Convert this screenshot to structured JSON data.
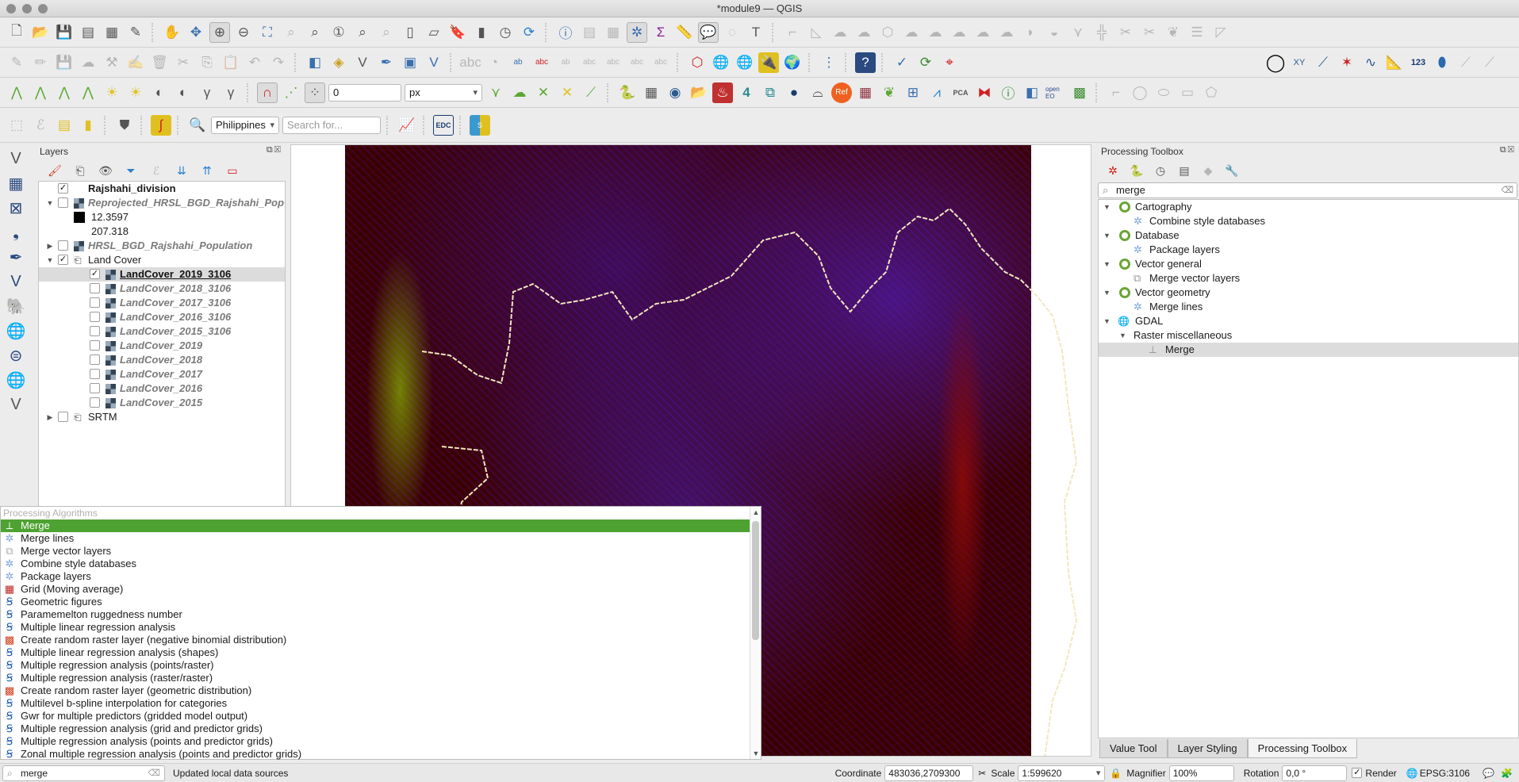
{
  "window": {
    "title": "*module9 — QGIS"
  },
  "toolbars": {
    "row1": [
      "new-project",
      "open-project",
      "save-project",
      "new-print-layout",
      "layout-manager",
      "style-manager",
      "pan",
      "pan-to-selection",
      "zoom-in",
      "zoom-out",
      "zoom-full",
      "zoom-to-selection",
      "zoom-to-layer",
      "zoom-native",
      "zoom-last",
      "zoom-next",
      "new-spatial-bookmark",
      "new-3d-map",
      "show-bookmarks",
      "temporal-controller",
      "refresh",
      "identify",
      "attribute-table",
      "field-calculator",
      "processing-toolbox",
      "statistical-summary",
      "measure",
      "map-tips",
      "select-features",
      "text-annotation"
    ],
    "snap_tolerance": "0",
    "snap_units": "px",
    "geocoder": {
      "country": "Philippines",
      "placeholder": "Search for..."
    },
    "edc_label": "EDC",
    "pca_label": "PCA",
    "ref_label": "Ref",
    "measure_123_label": "123",
    "openeo_label": "open EO"
  },
  "layers_panel": {
    "title": "Layers",
    "items": [
      {
        "name": "Rajshahi_division",
        "checked": true,
        "style": "bold",
        "indent": 1,
        "type": "vector"
      },
      {
        "name": "Reprojected_HRSL_BGD_Rajshahi_Pop",
        "checked": false,
        "style": "italic",
        "indent": 1,
        "expanded": true,
        "type": "raster"
      },
      {
        "name": "12.3597",
        "legend": true,
        "indent": 2
      },
      {
        "name": "207.318",
        "legend": true,
        "indent": 2,
        "nobox": true
      },
      {
        "name": "HRSL_BGD_Rajshahi_Population",
        "checked": false,
        "style": "italic",
        "indent": 1,
        "collapsed": true,
        "type": "raster"
      },
      {
        "name": "Land Cover",
        "checked": true,
        "style": "normal",
        "indent": 1,
        "expanded": true,
        "type": "group"
      },
      {
        "name": "LandCover_2019_3106",
        "checked": true,
        "style": "selected",
        "indent": 2,
        "type": "raster"
      },
      {
        "name": "LandCover_2018_3106",
        "checked": false,
        "style": "italic",
        "indent": 2,
        "type": "raster"
      },
      {
        "name": "LandCover_2017_3106",
        "checked": false,
        "style": "italic",
        "indent": 2,
        "type": "raster"
      },
      {
        "name": "LandCover_2016_3106",
        "checked": false,
        "style": "italic",
        "indent": 2,
        "type": "raster"
      },
      {
        "name": "LandCover_2015_3106",
        "checked": false,
        "style": "italic",
        "indent": 2,
        "type": "raster"
      },
      {
        "name": "LandCover_2019",
        "checked": false,
        "style": "italic",
        "indent": 2,
        "type": "raster"
      },
      {
        "name": "LandCover_2018",
        "checked": false,
        "style": "italic",
        "indent": 2,
        "type": "raster"
      },
      {
        "name": "LandCover_2017",
        "checked": false,
        "style": "italic",
        "indent": 2,
        "type": "raster"
      },
      {
        "name": "LandCover_2016",
        "checked": false,
        "style": "italic",
        "indent": 2,
        "type": "raster"
      },
      {
        "name": "LandCover_2015",
        "checked": false,
        "style": "italic",
        "indent": 2,
        "type": "raster"
      },
      {
        "name": "SRTM",
        "checked": false,
        "style": "normal",
        "indent": 1,
        "collapsed": true,
        "type": "group"
      }
    ]
  },
  "locator_popup": {
    "header": "Processing Algorithms",
    "items": [
      {
        "label": "Merge",
        "icon": "gdal-merge-icon",
        "selected": true
      },
      {
        "label": "Merge lines",
        "icon": "gear-icon"
      },
      {
        "label": "Merge vector layers",
        "icon": "merge-vector-icon"
      },
      {
        "label": "Combine style databases",
        "icon": "gear-icon"
      },
      {
        "label": "Package layers",
        "icon": "gear-icon"
      },
      {
        "label": "Grid (Moving average)",
        "icon": "grid-icon"
      },
      {
        "label": "Geometric figures",
        "icon": "saga-icon"
      },
      {
        "label": "Paramemelton ruggedness number",
        "icon": "saga-icon"
      },
      {
        "label": "Multiple linear regression analysis",
        "icon": "saga-icon"
      },
      {
        "label": "Create random raster layer (negative binomial distribution)",
        "icon": "random-raster-icon"
      },
      {
        "label": "Multiple linear regression analysis (shapes)",
        "icon": "saga-icon"
      },
      {
        "label": "Multiple regression analysis (points/raster)",
        "icon": "saga-icon"
      },
      {
        "label": "Multiple regression analysis (raster/raster)",
        "icon": "saga-icon"
      },
      {
        "label": "Create random raster layer (geometric distribution)",
        "icon": "random-raster-icon"
      },
      {
        "label": "Multilevel b-spline interpolation for categories",
        "icon": "saga-icon"
      },
      {
        "label": "Gwr for multiple predictors (gridded model output)",
        "icon": "saga-icon"
      },
      {
        "label": "Multiple regression analysis (grid and predictor grids)",
        "icon": "saga-icon"
      },
      {
        "label": "Multiple regression analysis (points and predictor grids)",
        "icon": "saga-icon"
      },
      {
        "label": "Zonal multiple regression analysis (points and predictor grids)",
        "icon": "saga-icon"
      }
    ]
  },
  "locator": {
    "value": "merge",
    "status": "Updated local data sources"
  },
  "processing_toolbox": {
    "title": "Processing Toolbox",
    "search_value": "merge",
    "tree": [
      {
        "label": "Cartography",
        "kind": "provider",
        "indent": 0
      },
      {
        "label": "Combine style databases",
        "kind": "gear",
        "indent": 1
      },
      {
        "label": "Database",
        "kind": "provider",
        "indent": 0
      },
      {
        "label": "Package layers",
        "kind": "gear",
        "indent": 1
      },
      {
        "label": "Vector general",
        "kind": "provider",
        "indent": 0
      },
      {
        "label": "Merge vector layers",
        "kind": "merge",
        "indent": 1
      },
      {
        "label": "Vector geometry",
        "kind": "provider",
        "indent": 0
      },
      {
        "label": "Merge lines",
        "kind": "gear",
        "indent": 1
      },
      {
        "label": "GDAL",
        "kind": "gdal",
        "indent": 0
      },
      {
        "label": "Raster miscellaneous",
        "kind": "group",
        "indent": 1
      },
      {
        "label": "Merge",
        "kind": "tool",
        "indent": 2,
        "selected": true
      }
    ],
    "tabs": [
      {
        "label": "Value Tool",
        "active": false
      },
      {
        "label": "Layer Styling",
        "active": false
      },
      {
        "label": "Processing Toolbox",
        "active": true
      }
    ]
  },
  "statusbar": {
    "coordinate_label": "Coordinate",
    "coordinate_value": "483036,2709300",
    "scale_label": "Scale",
    "scale_value": "1:599620",
    "magnifier_label": "Magnifier",
    "magnifier_value": "100%",
    "rotation_label": "Rotation",
    "rotation_value": "0,0 °",
    "render_label": "Render",
    "render_checked": true,
    "crs": "EPSG:3106"
  },
  "colors": {
    "selection_green": "#4ea232",
    "raster_background": "#3a0000",
    "water_blue": "#4b28f0",
    "vegetation_yellow_green": "#aaff00"
  }
}
